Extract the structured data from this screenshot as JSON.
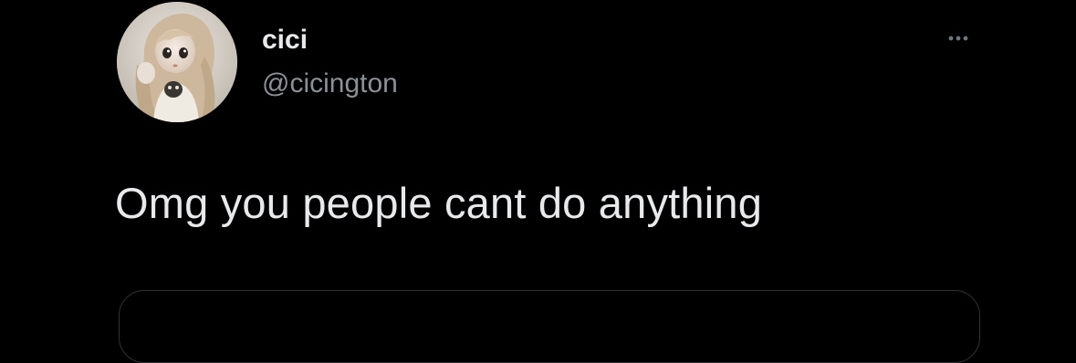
{
  "tweet": {
    "author": {
      "display_name": "cici",
      "handle": "@cicington",
      "avatar_icon": "doll-avatar-photo"
    },
    "more_icon": "ellipsis-icon",
    "text": "Omg you people cant do anything"
  },
  "colors": {
    "background": "#000000",
    "primary_text": "#e7e9ea",
    "secondary_text": "#8b9196",
    "border": "#2f3336"
  }
}
